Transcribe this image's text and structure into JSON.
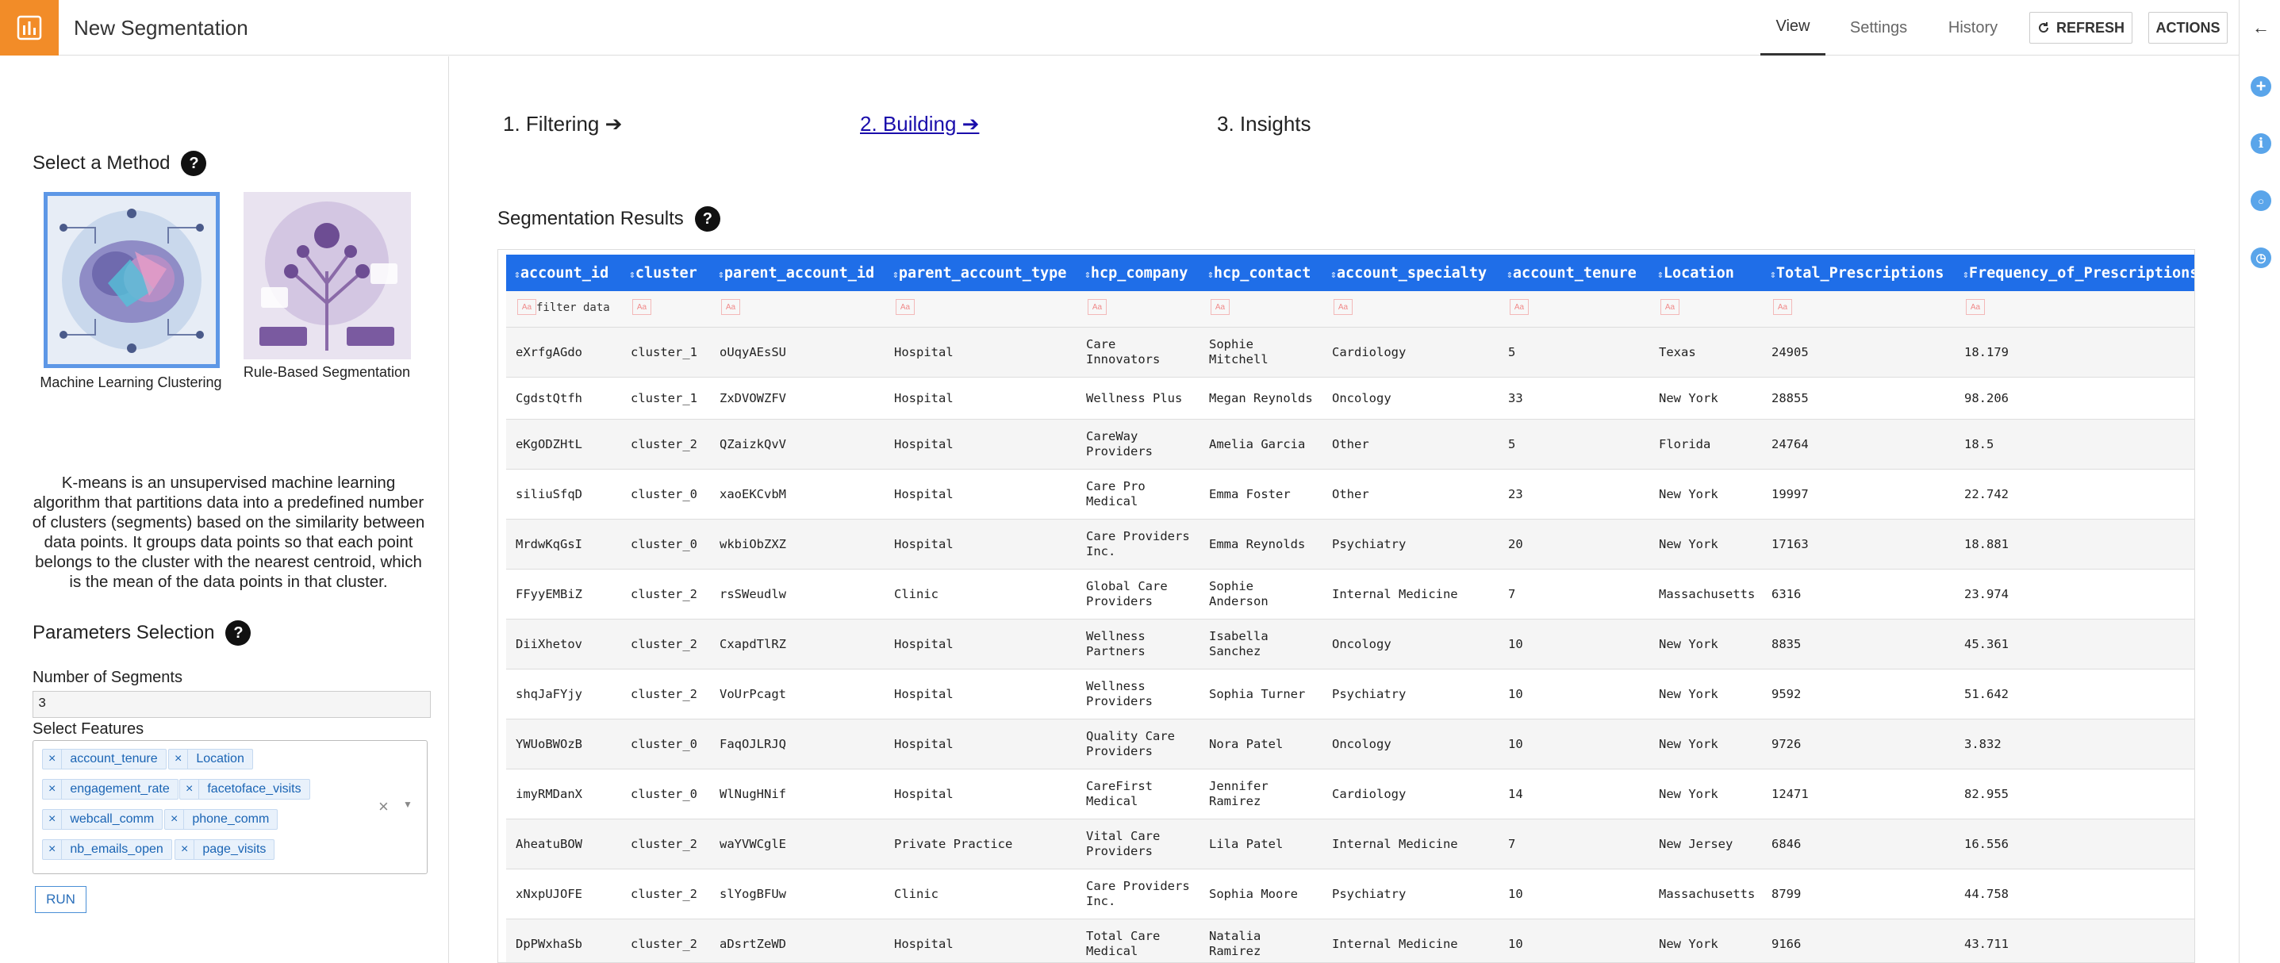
{
  "header": {
    "title": "New Segmentation",
    "nav": [
      "View",
      "Settings",
      "History"
    ],
    "refresh_label": "REFRESH",
    "actions_label": "ACTIONS"
  },
  "colors": {
    "brand": "#f28c28",
    "table_header": "#1f6ee8",
    "link": "#1a0dab"
  },
  "rail_icons": [
    "arrow-left-icon",
    "plus-icon",
    "info-icon",
    "chat-icon",
    "history-icon"
  ],
  "left": {
    "method_title": "Select a Method",
    "methods": [
      {
        "label": "Machine Learning Clustering",
        "selected": true
      },
      {
        "label": "Rule-Based Segmentation",
        "selected": false
      }
    ],
    "description": "K-means is an unsupervised machine learning algorithm that partitions data into a predefined number of clusters (segments) based on the similarity between data points. It groups data points so that each point belongs to the cluster with the nearest centroid, which is the mean of the data points in that cluster.",
    "params_title": "Parameters Selection",
    "num_segments_label": "Number of Segments",
    "num_segments_value": "3",
    "features_label": "Select Features",
    "features": [
      "account_tenure",
      "Location",
      "engagement_rate",
      "facetoface_visits",
      "webcall_comm",
      "phone_comm",
      "nb_emails_open",
      "page_visits"
    ],
    "run_label": "RUN"
  },
  "steps": [
    "1. Filtering ➔",
    "2. Building ➔",
    "3. Insights"
  ],
  "results": {
    "title": "Segmentation Results",
    "filter_placeholder": "filter data",
    "columns": [
      "account_id",
      "cluster",
      "parent_account_id",
      "parent_account_type",
      "hcp_company",
      "hcp_contact",
      "account_specialty",
      "account_tenure",
      "Location",
      "Total_Prescriptions",
      "Frequency_of_Prescriptions"
    ],
    "rows": [
      [
        "eXrfgAGdo",
        "cluster_1",
        "oUqyAEsSU",
        "Hospital",
        "Care Innovators",
        "Sophie Mitchell",
        "Cardiology",
        "5",
        "Texas",
        "24905",
        "18.179"
      ],
      [
        "CgdstQtfh",
        "cluster_1",
        "ZxDVOWZFV",
        "Hospital",
        "Wellness Plus",
        "Megan Reynolds",
        "Oncology",
        "33",
        "New York",
        "28855",
        "98.206"
      ],
      [
        "eKgODZHtL",
        "cluster_2",
        "QZaizkQvV",
        "Hospital",
        "CareWay Providers",
        "Amelia Garcia",
        "Other",
        "5",
        "Florida",
        "24764",
        "18.5"
      ],
      [
        "siliuSfqD",
        "cluster_0",
        "xaoEKCvbM",
        "Hospital",
        "Care Pro Medical",
        "Emma Foster",
        "Other",
        "23",
        "New York",
        "19997",
        "22.742"
      ],
      [
        "MrdwKqGsI",
        "cluster_0",
        "wkbiObZXZ",
        "Hospital",
        "Care Providers Inc.",
        "Emma Reynolds",
        "Psychiatry",
        "20",
        "New York",
        "17163",
        "18.881"
      ],
      [
        "FFyyEMBiZ",
        "cluster_2",
        "rsSWeudlw",
        "Clinic",
        "Global Care Providers",
        "Sophie Anderson",
        "Internal Medicine",
        "7",
        "Massachusetts",
        "6316",
        "23.974"
      ],
      [
        "DiiXhetov",
        "cluster_2",
        "CxapdTlRZ",
        "Hospital",
        "Wellness Partners",
        "Isabella Sanchez",
        "Oncology",
        "10",
        "New York",
        "8835",
        "45.361"
      ],
      [
        "shqJaFYjy",
        "cluster_2",
        "VoUrPcagt",
        "Hospital",
        "Wellness Providers",
        "Sophia Turner",
        "Psychiatry",
        "10",
        "New York",
        "9592",
        "51.642"
      ],
      [
        "YWUoBWOzB",
        "cluster_0",
        "FaqOJLRJQ",
        "Hospital",
        "Quality Care Providers",
        "Nora Patel",
        "Oncology",
        "10",
        "New York",
        "9726",
        "3.832"
      ],
      [
        "imyRMDanX",
        "cluster_0",
        "WlNugHNif",
        "Hospital",
        "CareFirst Medical",
        "Jennifer Ramirez",
        "Cardiology",
        "14",
        "New York",
        "12471",
        "82.955"
      ],
      [
        "AheatuBOW",
        "cluster_2",
        "waYVWCglE",
        "Private Practice",
        "Vital Care Providers",
        "Lila Patel",
        "Internal Medicine",
        "7",
        "New Jersey",
        "6846",
        "16.556"
      ],
      [
        "xNxpUJOFE",
        "cluster_2",
        "slYogBFUw",
        "Clinic",
        "Care Providers Inc.",
        "Sophia Moore",
        "Psychiatry",
        "10",
        "Massachusetts",
        "8799",
        "44.758"
      ],
      [
        "DpPWxhaSb",
        "cluster_2",
        "aDsrtZeWD",
        "Hospital",
        "Total Care Medical",
        "Natalia Ramirez",
        "Internal Medicine",
        "10",
        "New York",
        "9166",
        "43.711"
      ]
    ]
  }
}
